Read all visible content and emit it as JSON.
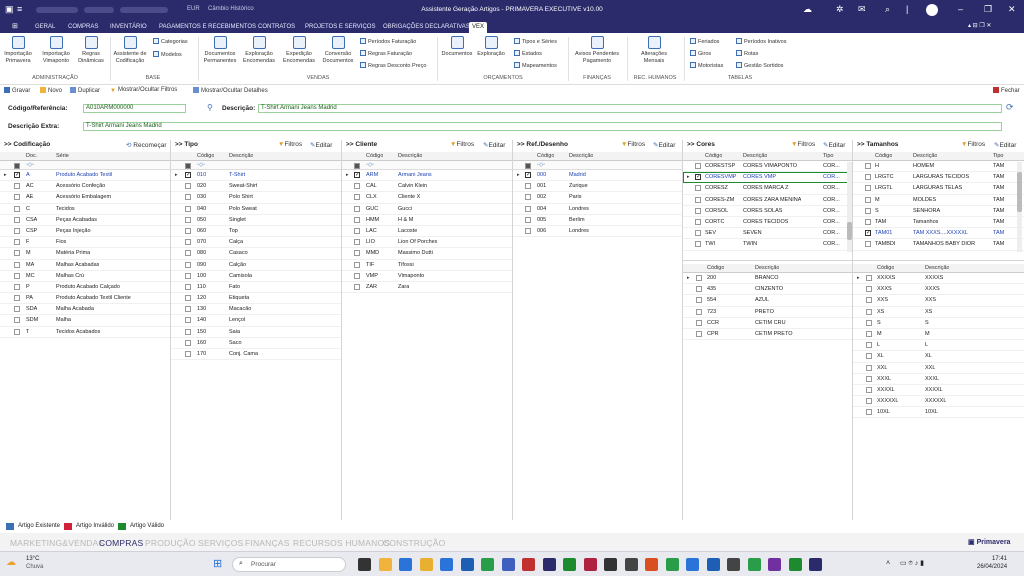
{
  "window": {
    "title": "Assistente Geração Artigos - PRIMAVERA EXECUTIVE v10.00",
    "currency": "EUR",
    "cambio": "Câmbio Histórico"
  },
  "menu": {
    "tabs": [
      "GERAL",
      "COMPRAS",
      "INVENTÁRIO",
      "PAGAMENTOS E RECEBIMENTOS",
      "CONTRATOS",
      "PROJETOS E SERVIÇOS",
      "OBRIGAÇÕES DECLARATIVAS",
      "VEX"
    ],
    "active": "VEX"
  },
  "ribbon": {
    "buttons": [
      "Importação Primavera",
      "Importação Vimaponto",
      "Regras Dinâmicas",
      "Assistente de Codificação",
      "Documentos Permanentes",
      "Exploração Encomendas",
      "Expedição Encomendas",
      "Conversão Documentos",
      "Documentos",
      "Exploração",
      "Avisos Pendentes Pagamento",
      "Alterações Mensais"
    ],
    "small": [
      "Categorias",
      "Modelos",
      "Períodos Faturação",
      "Regras Faturação",
      "Regras Desconto Preço",
      "Tipos e Séries",
      "Estados",
      "Mapeamentos",
      "Feriados",
      "Giros",
      "Motoristas",
      "Períodos Inativos",
      "Rotas",
      "Gestão Sortidos"
    ],
    "groups": [
      "ADMINISTRAÇÃO",
      "BASE",
      "VENDAS",
      "ORÇAMENTOS",
      "FINANÇAS",
      "REC. HUMANOS",
      "TABELAS"
    ]
  },
  "toolbar": {
    "gravar": "Gravar",
    "novo": "Novo",
    "duplicar": "Duplicar",
    "filtros": "Mostrar/Ocultar Filtros",
    "detalhes": "Mostrar/Ocultar Detalhes",
    "fechar": "Fechar"
  },
  "form": {
    "codigo_label": "Código/Referência:",
    "codigo_value": "A010ARM000000",
    "descricao_label": "Descrição:",
    "descricao_value": "T-Shirt Armani Jeans Madrid",
    "extra_label": "Descrição Extra:",
    "extra_value": "T-Shirt Armani Jeans Madrid"
  },
  "common": {
    "filtros": "Filtros",
    "editar": "Editar",
    "recomecar": "Recomeçar"
  },
  "panels": {
    "codificacao": {
      "title": ">> Codificação",
      "cols": [
        "Doc.",
        "Série"
      ],
      "rows": [
        [
          "A",
          "Produto Acabado Textil"
        ],
        [
          "AC",
          "Acessório Confeção"
        ],
        [
          "AE",
          "Acessório Embalagem"
        ],
        [
          "C",
          "Tecidos"
        ],
        [
          "CSA",
          "Peças Acabadas"
        ],
        [
          "CSP",
          "Peças Injeção"
        ],
        [
          "F",
          "Fios"
        ],
        [
          "M",
          "Matéria Prima"
        ],
        [
          "MA",
          "Malhas Acabadas"
        ],
        [
          "MC",
          "Malhas Crú"
        ],
        [
          "P",
          "Produto Acabado Calçado"
        ],
        [
          "PA",
          "Produto Acabado Textil Cliente"
        ],
        [
          "SDA",
          "Malha Acabada"
        ],
        [
          "SDM",
          "Malha"
        ],
        [
          "T",
          "Tecidos Acabados"
        ]
      ]
    },
    "tipo": {
      "title": ">> Tipo",
      "cols": [
        "Código",
        "Descrição"
      ],
      "rows": [
        [
          "010",
          "T-Shirt"
        ],
        [
          "020",
          "Sweat-Shirt"
        ],
        [
          "030",
          "Polo Shirt"
        ],
        [
          "040",
          "Polo Sweat"
        ],
        [
          "050",
          "Singlet"
        ],
        [
          "060",
          "Top"
        ],
        [
          "070",
          "Calça"
        ],
        [
          "080",
          "Casaco"
        ],
        [
          "090",
          "Calção"
        ],
        [
          "100",
          "Camisola"
        ],
        [
          "110",
          "Fato"
        ],
        [
          "120",
          "Etiqueta"
        ],
        [
          "130",
          "Macacão"
        ],
        [
          "140",
          "Lençol"
        ],
        [
          "150",
          "Saia"
        ],
        [
          "160",
          "Saco"
        ],
        [
          "170",
          "Conj. Cama"
        ]
      ]
    },
    "cliente": {
      "title": ">> Cliente",
      "cols": [
        "Código",
        "Descrição"
      ],
      "rows": [
        [
          "ARM",
          "Armani Jeans"
        ],
        [
          "CAL",
          "Calvin Klein"
        ],
        [
          "CLX",
          "Cliente X"
        ],
        [
          "GUC",
          "Gucci"
        ],
        [
          "HMM",
          "H & M"
        ],
        [
          "LAC",
          "Lacoste"
        ],
        [
          "LIO",
          "Lion Of Porches"
        ],
        [
          "MMD",
          "Massimo Dutti"
        ],
        [
          "TIF",
          "Tifossi"
        ],
        [
          "VMP",
          "Vimaponto"
        ],
        [
          "ZAR",
          "Zara"
        ]
      ]
    },
    "refdesenho": {
      "title": ">> Ref./Desenho",
      "cols": [
        "Código",
        "Descrição"
      ],
      "rows": [
        [
          "000",
          "Madrid"
        ],
        [
          "001",
          "Zurique"
        ],
        [
          "002",
          "Paris"
        ],
        [
          "004",
          "Londres"
        ],
        [
          "005",
          "Berlim"
        ],
        [
          "006",
          "Londres"
        ]
      ]
    },
    "cores": {
      "title": ">> Cores",
      "cols": [
        "Código",
        "Descrição",
        "Tipo"
      ],
      "rows": [
        [
          "CORESTSP",
          "CORES VIMAPONTO",
          "COR..."
        ],
        [
          "CORESVMP",
          "CORES VMP",
          "COR..."
        ],
        [
          "CORESZ",
          "CORES MARCA Z",
          "COR..."
        ],
        [
          "CORES-ZM",
          "CORES ZARA MENINA",
          "COR..."
        ],
        [
          "CORSOL",
          "CORES SOLAS",
          "COR..."
        ],
        [
          "CORTC",
          "CORES TECIDOS",
          "COR..."
        ],
        [
          "SEV",
          "SEVEN",
          "COR..."
        ],
        [
          "TWI",
          "TWIN",
          "COR..."
        ]
      ],
      "detail_cols": [
        "Código",
        "Descrição"
      ],
      "detail_rows": [
        [
          "200",
          "BRANCO"
        ],
        [
          "435",
          "CINZENTO"
        ],
        [
          "554",
          "AZUL"
        ],
        [
          "723",
          "PRETO"
        ],
        [
          "CCR",
          "CETIM CRU"
        ],
        [
          "CPR",
          "CETIM PRETO"
        ]
      ]
    },
    "tamanhos": {
      "title": ">> Tamanhos",
      "cols": [
        "Código",
        "Descrição",
        "Tipo"
      ],
      "rows": [
        [
          "H",
          "HOMEM",
          "TAM"
        ],
        [
          "LRGTC",
          "LARGURAS TECIDOS",
          "TAM"
        ],
        [
          "LRGTL",
          "LARGURAS TELAS",
          "TAM"
        ],
        [
          "M",
          "MOLDES",
          "TAM"
        ],
        [
          "S",
          "SENHORA",
          "TAM"
        ],
        [
          "TAM",
          "Tamanhos",
          "TAM"
        ],
        [
          "TAM01",
          "TAM XXXS....XXXXXL",
          "TAM"
        ],
        [
          "TAMBDI",
          "TAMANHOS BABY DIOR",
          "TAM"
        ]
      ],
      "detail_cols": [
        "Código",
        "Descrição"
      ],
      "detail_rows": [
        [
          "XXXXS",
          "XXXXS"
        ],
        [
          "XXXS",
          "XXXS"
        ],
        [
          "XXS",
          "XXS"
        ],
        [
          "XS",
          "XS"
        ],
        [
          "S",
          "S"
        ],
        [
          "M",
          "M"
        ],
        [
          "L",
          "L"
        ],
        [
          "XL",
          "XL"
        ],
        [
          "XXL",
          "XXL"
        ],
        [
          "XXXL",
          "XXXL"
        ],
        [
          "XXXXL",
          "XXXXL"
        ],
        [
          "XXXXXL",
          "XXXXXL"
        ],
        [
          "10XL",
          "10XL"
        ]
      ]
    }
  },
  "legend": {
    "existente": "Artigo Existente",
    "invalido": "Artigo Inválido",
    "valido": "Artigo Válido",
    "colors": {
      "existente": "#3d6fb5",
      "invalido": "#d0203a",
      "valido": "#1e8a2e"
    }
  },
  "modules": [
    "MARKETING&VENDAS",
    "COMPRAS",
    "PRODUÇÃO",
    "SERVIÇOS",
    "FINANÇAS",
    "RECURSOS HUMANOS",
    "CONSTRUÇÃO"
  ],
  "active_module": "COMPRAS",
  "brand": "Primavera",
  "taskbar": {
    "weather_temp": "13°C",
    "weather_desc": "Chuva",
    "search": "Procurar",
    "time": "17:41",
    "date": "26/04/2024"
  }
}
